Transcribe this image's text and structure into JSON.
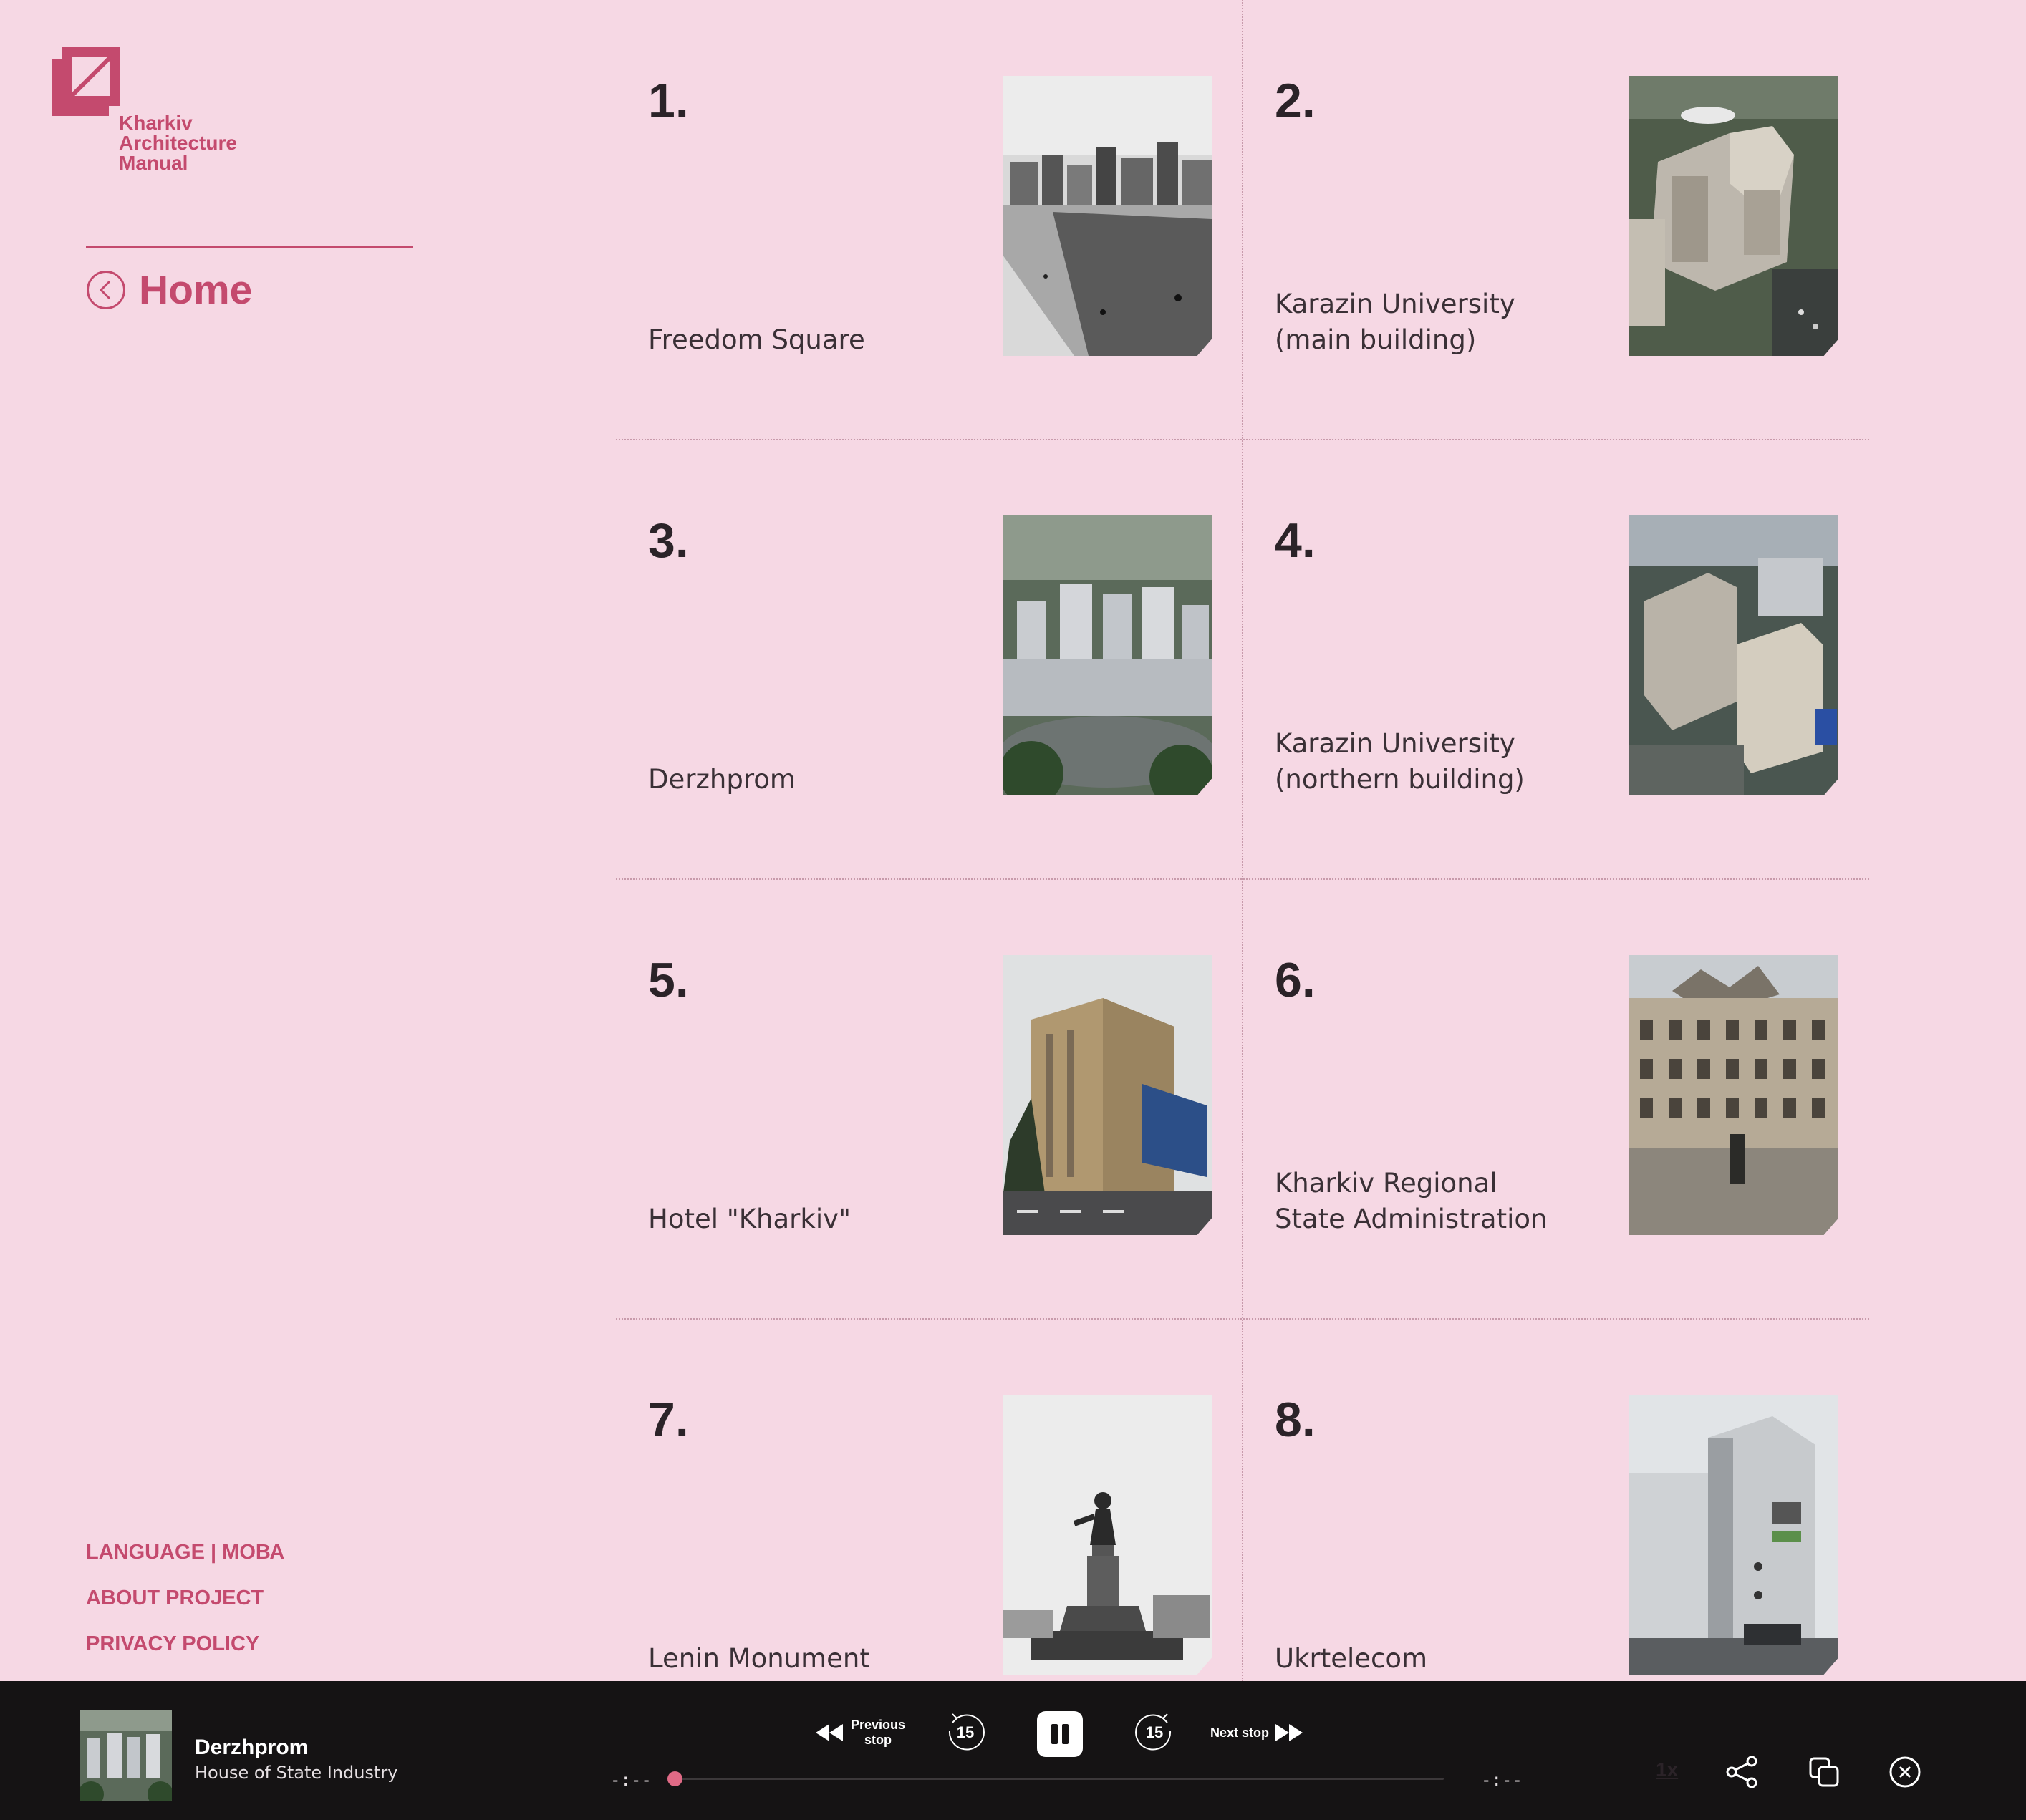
{
  "brand": {
    "line1": "Kharkiv",
    "line2": "Architecture",
    "line3": "Manual",
    "accent_color": "#c44a6e",
    "background": "#f6d8e4"
  },
  "nav": {
    "home_label": "Home",
    "home_icon": "chevron-left-circle-icon"
  },
  "footer_links": {
    "language": "LANGUAGE | МОВА",
    "about": "ABOUT PROJECT",
    "privacy": "PRIVACY POLICY"
  },
  "stops": [
    {
      "number": "1.",
      "name": "Freedom Square"
    },
    {
      "number": "2.",
      "name": "Karazin University (main building)"
    },
    {
      "number": "3.",
      "name": "Derzhprom"
    },
    {
      "number": "4.",
      "name": "Karazin University (northern building)"
    },
    {
      "number": "5.",
      "name": "Hotel \"Kharkiv\""
    },
    {
      "number": "6.",
      "name": "Kharkiv Regional State Administration"
    },
    {
      "number": "7.",
      "name": "Lenin Monument"
    },
    {
      "number": "8.",
      "name": "Ukrtelecom"
    }
  ],
  "player": {
    "title": "Derzhprom",
    "subtitle": "House of State Industry",
    "previous_label_1": "Previous",
    "previous_label_2": "stop",
    "next_label": "Next stop",
    "skip_back": "15",
    "skip_forward": "15",
    "elapsed": "-:--",
    "remaining": "-:--",
    "speed": "1x",
    "progress": 0,
    "icons": [
      "rewind-icon",
      "replay-15-icon",
      "pause-icon",
      "forward-15-icon",
      "fast-forward-icon",
      "share-icon",
      "copy-icon",
      "close-circle-icon"
    ]
  }
}
